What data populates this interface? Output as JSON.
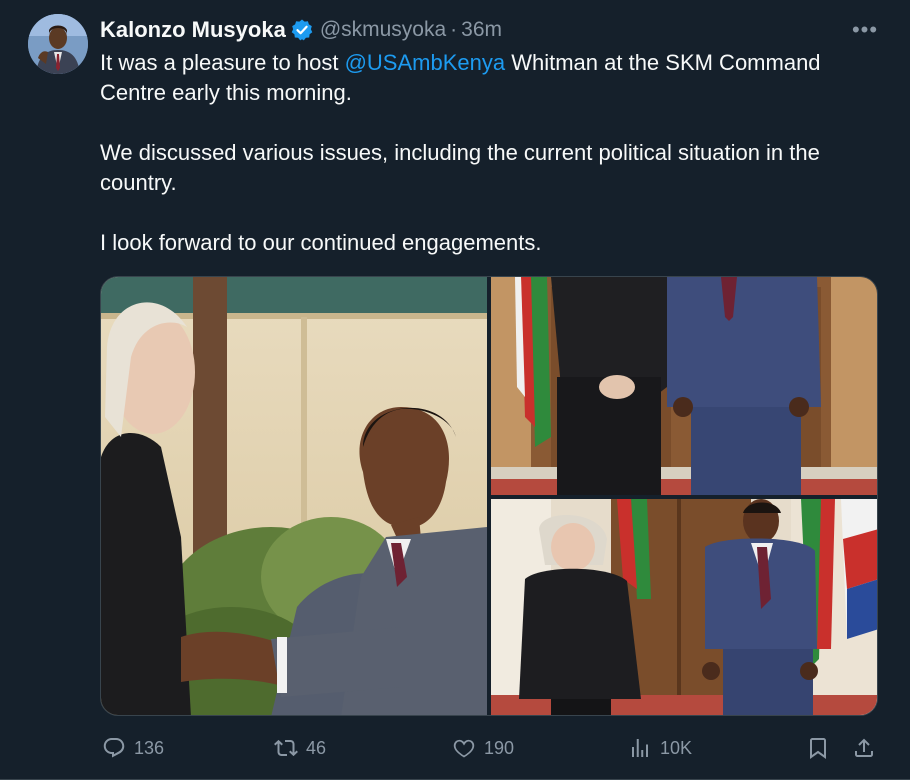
{
  "author": {
    "name": "Kalonzo Musyoka",
    "handle": "@skmusyoka",
    "separator": "·",
    "time": "36m"
  },
  "tweet": {
    "line1_prefix": "It was a pleasure to host ",
    "mention": "@USAmbKenya",
    "line1_suffix": " Whitman at the SKM Command Centre early this morning.",
    "paragraph2": "We discussed various issues, including the current political situation in the country.",
    "paragraph3": "I look forward to our continued engagements."
  },
  "icons": {
    "verified": "verified-badge-icon",
    "more": "more-options-icon",
    "reply": "reply-icon",
    "retweet": "retweet-icon",
    "like": "like-icon",
    "views": "views-icon",
    "bookmark": "bookmark-icon",
    "share": "share-icon"
  },
  "metrics": {
    "replies": "136",
    "retweets": "46",
    "likes": "190",
    "views": "10K"
  },
  "more_label": "•••",
  "colors": {
    "background": "#15202b",
    "text": "#f7f9f9",
    "secondary": "#8b98a5",
    "link": "#1d9bf0",
    "verified": "#1d9bf0"
  }
}
